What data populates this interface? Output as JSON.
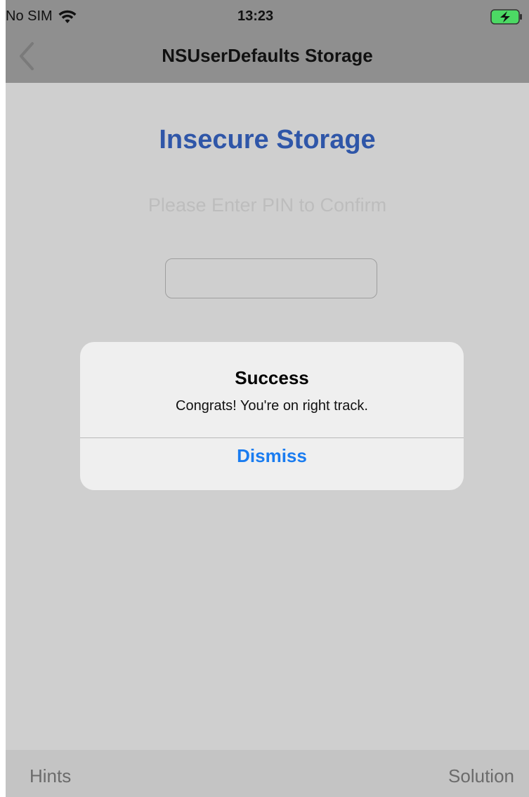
{
  "status_bar": {
    "carrier": "No SIM",
    "time": "13:23",
    "wifi_icon": "wifi-icon",
    "battery_icon": "battery-charging-icon",
    "battery_color": "#4cd964"
  },
  "nav_bar": {
    "title": "NSUserDefaults Storage",
    "back_icon": "chevron-left-icon"
  },
  "main": {
    "title": "Insecure Storage",
    "pin_prompt": "Please Enter PIN to Confirm",
    "pin_value": ""
  },
  "alert": {
    "title": "Success",
    "message": "Congrats! You're on right track.",
    "dismiss_label": "Dismiss"
  },
  "toolbar": {
    "hints_label": "Hints",
    "solution_label": "Solution"
  },
  "colors": {
    "accent": "#2f56a8",
    "link": "#1a7cf0"
  }
}
